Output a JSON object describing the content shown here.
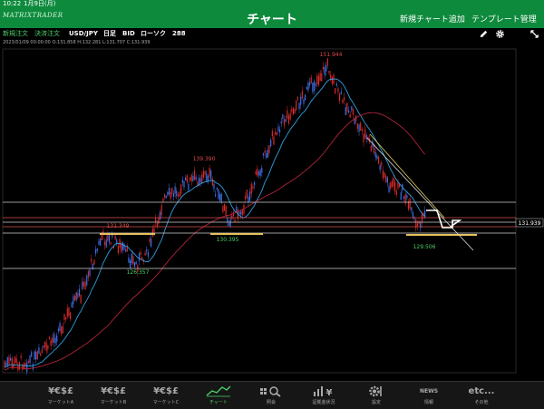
{
  "status_bar": {
    "time": "10:22",
    "date": "1月9日(月)"
  },
  "header": {
    "logo": "MATRIXTRADER",
    "title": "チャート",
    "add_chart": "新規チャート追加",
    "template": "テンプレート管理"
  },
  "toolbar": {
    "new_order": "新規注文",
    "settle_order": "決済注文",
    "pair": "USD/JPY",
    "timeframe": "日足",
    "side": "BID",
    "chart_kind": "ローソク",
    "bars": "288",
    "pencil_icon": "pencil-icon",
    "settings_icon": "gear-icon",
    "expand_icon": "expand-icon"
  },
  "ohlc_line": "2023/01/09 00:00:00   O:131.858   H:132.281   L:131.707   C:131.939",
  "chart": {
    "price_tag": "131.939",
    "labels": {
      "high": "151.944",
      "p139": "139.390",
      "p131": "131.349",
      "p130": "130.395",
      "p126": "126.357",
      "p129": "129.506"
    },
    "colors": {
      "bull": "#3f6fe8",
      "bear": "#d82a2a",
      "ma_short": "#2f9fe0",
      "ma_long": "#b0243a",
      "support": "#e8c35a"
    }
  },
  "tabs": [
    {
      "label": "マーケットA",
      "icon": "¥€$£"
    },
    {
      "label": "マーケットB",
      "icon": "¥€$£"
    },
    {
      "label": "マーケットC",
      "icon": "¥€$£"
    },
    {
      "label": "チャート",
      "icon": "chart-icon"
    },
    {
      "label": "照会",
      "icon": "search-icon"
    },
    {
      "label": "証拠金状況",
      "icon": "margin-icon"
    },
    {
      "label": "設定",
      "icon": "gear-icon"
    },
    {
      "label": "情報",
      "icon": "NEWS"
    },
    {
      "label": "その他",
      "icon": "etc..."
    }
  ]
}
